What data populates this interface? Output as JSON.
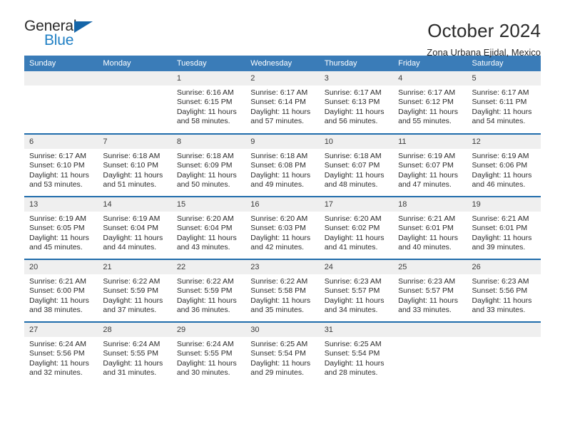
{
  "brand": {
    "name_part1": "General",
    "name_part2": "Blue",
    "triangle_color": "#1565a8",
    "blue_color": "#1f7fc4"
  },
  "header": {
    "title": "October 2024",
    "subtitle": "Zona Urbana Ejidal, Mexico",
    "header_bg": "#3a7cb8",
    "row_divider_color": "#1f6cab",
    "daynum_bg": "#efefef"
  },
  "weekday_headers": [
    "Sunday",
    "Monday",
    "Tuesday",
    "Wednesday",
    "Thursday",
    "Friday",
    "Saturday"
  ],
  "labels": {
    "sunrise_prefix": "Sunrise:",
    "sunset_prefix": "Sunset:",
    "daylight_prefix": "Daylight:"
  },
  "weeks": [
    [
      {
        "day": "",
        "empty": true
      },
      {
        "day": "",
        "empty": true
      },
      {
        "day": "1",
        "sunrise": "Sunrise: 6:16 AM",
        "sunset": "Sunset: 6:15 PM",
        "daylight_line1": "Daylight: 11 hours",
        "daylight_line2": "and 58 minutes."
      },
      {
        "day": "2",
        "sunrise": "Sunrise: 6:17 AM",
        "sunset": "Sunset: 6:14 PM",
        "daylight_line1": "Daylight: 11 hours",
        "daylight_line2": "and 57 minutes."
      },
      {
        "day": "3",
        "sunrise": "Sunrise: 6:17 AM",
        "sunset": "Sunset: 6:13 PM",
        "daylight_line1": "Daylight: 11 hours",
        "daylight_line2": "and 56 minutes."
      },
      {
        "day": "4",
        "sunrise": "Sunrise: 6:17 AM",
        "sunset": "Sunset: 6:12 PM",
        "daylight_line1": "Daylight: 11 hours",
        "daylight_line2": "and 55 minutes."
      },
      {
        "day": "5",
        "sunrise": "Sunrise: 6:17 AM",
        "sunset": "Sunset: 6:11 PM",
        "daylight_line1": "Daylight: 11 hours",
        "daylight_line2": "and 54 minutes."
      }
    ],
    [
      {
        "day": "6",
        "sunrise": "Sunrise: 6:17 AM",
        "sunset": "Sunset: 6:10 PM",
        "daylight_line1": "Daylight: 11 hours",
        "daylight_line2": "and 53 minutes."
      },
      {
        "day": "7",
        "sunrise": "Sunrise: 6:18 AM",
        "sunset": "Sunset: 6:10 PM",
        "daylight_line1": "Daylight: 11 hours",
        "daylight_line2": "and 51 minutes."
      },
      {
        "day": "8",
        "sunrise": "Sunrise: 6:18 AM",
        "sunset": "Sunset: 6:09 PM",
        "daylight_line1": "Daylight: 11 hours",
        "daylight_line2": "and 50 minutes."
      },
      {
        "day": "9",
        "sunrise": "Sunrise: 6:18 AM",
        "sunset": "Sunset: 6:08 PM",
        "daylight_line1": "Daylight: 11 hours",
        "daylight_line2": "and 49 minutes."
      },
      {
        "day": "10",
        "sunrise": "Sunrise: 6:18 AM",
        "sunset": "Sunset: 6:07 PM",
        "daylight_line1": "Daylight: 11 hours",
        "daylight_line2": "and 48 minutes."
      },
      {
        "day": "11",
        "sunrise": "Sunrise: 6:19 AM",
        "sunset": "Sunset: 6:07 PM",
        "daylight_line1": "Daylight: 11 hours",
        "daylight_line2": "and 47 minutes."
      },
      {
        "day": "12",
        "sunrise": "Sunrise: 6:19 AM",
        "sunset": "Sunset: 6:06 PM",
        "daylight_line1": "Daylight: 11 hours",
        "daylight_line2": "and 46 minutes."
      }
    ],
    [
      {
        "day": "13",
        "sunrise": "Sunrise: 6:19 AM",
        "sunset": "Sunset: 6:05 PM",
        "daylight_line1": "Daylight: 11 hours",
        "daylight_line2": "and 45 minutes."
      },
      {
        "day": "14",
        "sunrise": "Sunrise: 6:19 AM",
        "sunset": "Sunset: 6:04 PM",
        "daylight_line1": "Daylight: 11 hours",
        "daylight_line2": "and 44 minutes."
      },
      {
        "day": "15",
        "sunrise": "Sunrise: 6:20 AM",
        "sunset": "Sunset: 6:04 PM",
        "daylight_line1": "Daylight: 11 hours",
        "daylight_line2": "and 43 minutes."
      },
      {
        "day": "16",
        "sunrise": "Sunrise: 6:20 AM",
        "sunset": "Sunset: 6:03 PM",
        "daylight_line1": "Daylight: 11 hours",
        "daylight_line2": "and 42 minutes."
      },
      {
        "day": "17",
        "sunrise": "Sunrise: 6:20 AM",
        "sunset": "Sunset: 6:02 PM",
        "daylight_line1": "Daylight: 11 hours",
        "daylight_line2": "and 41 minutes."
      },
      {
        "day": "18",
        "sunrise": "Sunrise: 6:21 AM",
        "sunset": "Sunset: 6:01 PM",
        "daylight_line1": "Daylight: 11 hours",
        "daylight_line2": "and 40 minutes."
      },
      {
        "day": "19",
        "sunrise": "Sunrise: 6:21 AM",
        "sunset": "Sunset: 6:01 PM",
        "daylight_line1": "Daylight: 11 hours",
        "daylight_line2": "and 39 minutes."
      }
    ],
    [
      {
        "day": "20",
        "sunrise": "Sunrise: 6:21 AM",
        "sunset": "Sunset: 6:00 PM",
        "daylight_line1": "Daylight: 11 hours",
        "daylight_line2": "and 38 minutes."
      },
      {
        "day": "21",
        "sunrise": "Sunrise: 6:22 AM",
        "sunset": "Sunset: 5:59 PM",
        "daylight_line1": "Daylight: 11 hours",
        "daylight_line2": "and 37 minutes."
      },
      {
        "day": "22",
        "sunrise": "Sunrise: 6:22 AM",
        "sunset": "Sunset: 5:59 PM",
        "daylight_line1": "Daylight: 11 hours",
        "daylight_line2": "and 36 minutes."
      },
      {
        "day": "23",
        "sunrise": "Sunrise: 6:22 AM",
        "sunset": "Sunset: 5:58 PM",
        "daylight_line1": "Daylight: 11 hours",
        "daylight_line2": "and 35 minutes."
      },
      {
        "day": "24",
        "sunrise": "Sunrise: 6:23 AM",
        "sunset": "Sunset: 5:57 PM",
        "daylight_line1": "Daylight: 11 hours",
        "daylight_line2": "and 34 minutes."
      },
      {
        "day": "25",
        "sunrise": "Sunrise: 6:23 AM",
        "sunset": "Sunset: 5:57 PM",
        "daylight_line1": "Daylight: 11 hours",
        "daylight_line2": "and 33 minutes."
      },
      {
        "day": "26",
        "sunrise": "Sunrise: 6:23 AM",
        "sunset": "Sunset: 5:56 PM",
        "daylight_line1": "Daylight: 11 hours",
        "daylight_line2": "and 33 minutes."
      }
    ],
    [
      {
        "day": "27",
        "sunrise": "Sunrise: 6:24 AM",
        "sunset": "Sunset: 5:56 PM",
        "daylight_line1": "Daylight: 11 hours",
        "daylight_line2": "and 32 minutes."
      },
      {
        "day": "28",
        "sunrise": "Sunrise: 6:24 AM",
        "sunset": "Sunset: 5:55 PM",
        "daylight_line1": "Daylight: 11 hours",
        "daylight_line2": "and 31 minutes."
      },
      {
        "day": "29",
        "sunrise": "Sunrise: 6:24 AM",
        "sunset": "Sunset: 5:55 PM",
        "daylight_line1": "Daylight: 11 hours",
        "daylight_line2": "and 30 minutes."
      },
      {
        "day": "30",
        "sunrise": "Sunrise: 6:25 AM",
        "sunset": "Sunset: 5:54 PM",
        "daylight_line1": "Daylight: 11 hours",
        "daylight_line2": "and 29 minutes."
      },
      {
        "day": "31",
        "sunrise": "Sunrise: 6:25 AM",
        "sunset": "Sunset: 5:54 PM",
        "daylight_line1": "Daylight: 11 hours",
        "daylight_line2": "and 28 minutes."
      },
      {
        "day": "",
        "empty": true
      },
      {
        "day": "",
        "empty": true
      }
    ]
  ]
}
